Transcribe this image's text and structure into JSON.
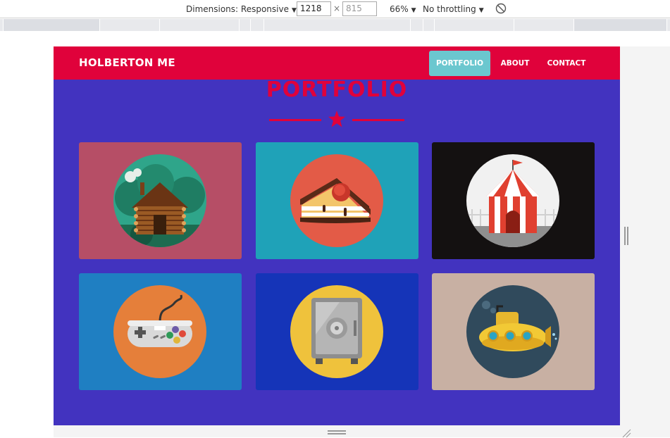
{
  "devtools": {
    "dimensions_label": "Dimensions: Responsive",
    "width_value": "1218",
    "height_placeholder": "815",
    "zoom": "66%",
    "throttling": "No throttling"
  },
  "site": {
    "brand": "HOLBERTON ME",
    "nav": [
      {
        "label": "PORTFOLIO",
        "active": true
      },
      {
        "label": "ABOUT",
        "active": false
      },
      {
        "label": "CONTACT",
        "active": false
      }
    ],
    "section_title": "PORTFOLIO"
  },
  "colors": {
    "nav": "#e0023b",
    "page_bg": "#4233bf",
    "active_tab": "#6bc7cf"
  },
  "portfolio": [
    {
      "icon": "log-cabin-icon",
      "card_color": "#b64e66",
      "circle_color": "#2fa58a"
    },
    {
      "icon": "cake-slice-icon",
      "card_color": "#1fa2b8",
      "circle_color": "#e35b47"
    },
    {
      "icon": "circus-tent-icon",
      "card_color": "#141111",
      "circle_color": "#f1f1f1"
    },
    {
      "icon": "game-controller-icon",
      "card_color": "#1f7fc2",
      "circle_color": "#e57f3a"
    },
    {
      "icon": "safe-icon",
      "card_color": "#1534b8",
      "circle_color": "#efc23c"
    },
    {
      "icon": "submarine-icon",
      "card_color": "#c8b0a3",
      "circle_color": "#304a5c"
    }
  ]
}
